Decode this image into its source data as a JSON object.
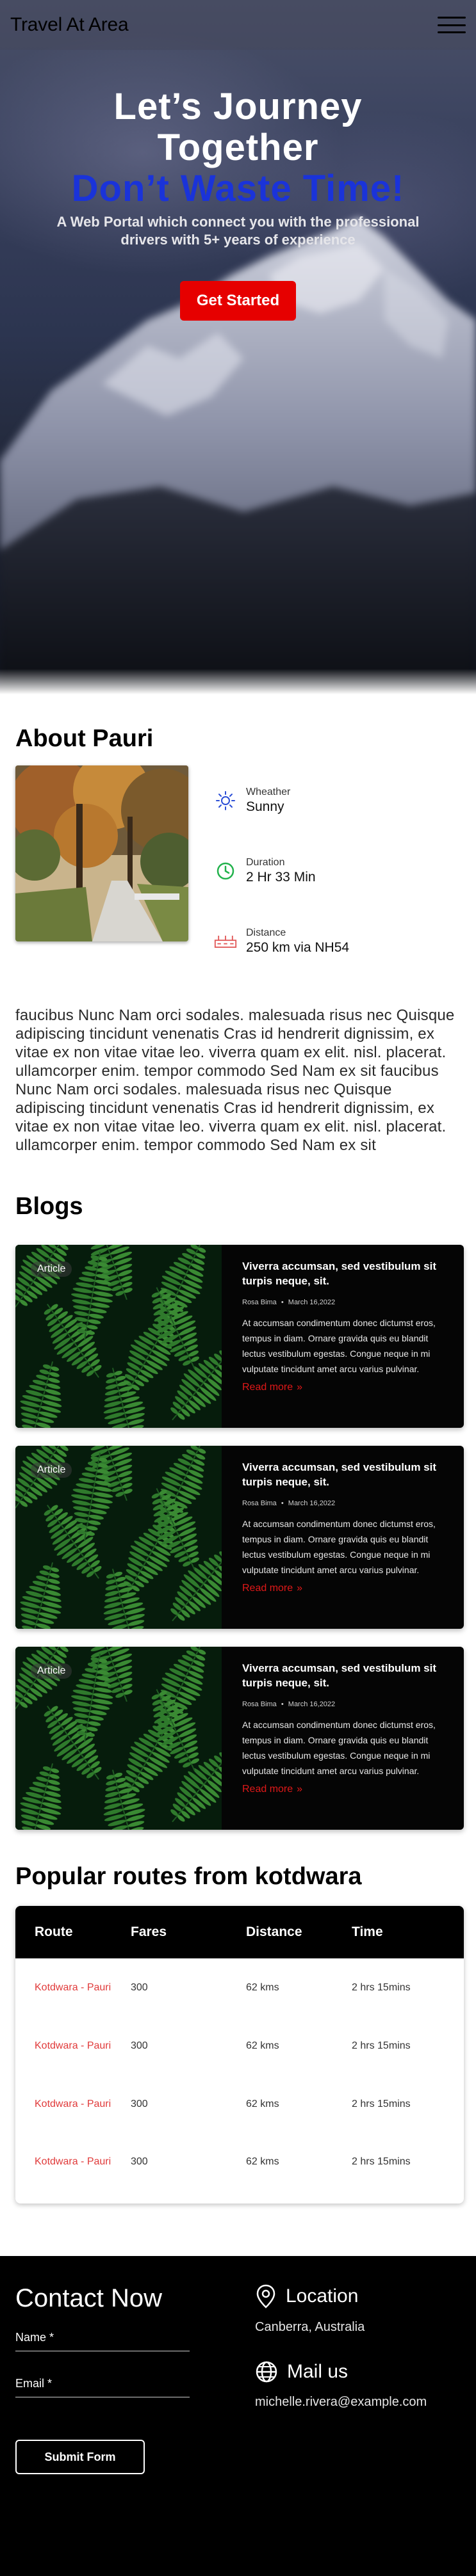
{
  "navbar": {
    "brand": "Travel At Area",
    "menu_icon": "hamburger-menu-icon"
  },
  "hero": {
    "title_line1": "Let’s Journey",
    "title_line2": "Together",
    "accent": "Don’t Waste Time!",
    "subtitle_line1": "A Web Portal which connect you with the professional",
    "subtitle_line2": "drivers with 5+ years of experience",
    "cta_label": "Get Started",
    "colors": {
      "accent": "#1a33d9",
      "cta": "#e60000"
    }
  },
  "about": {
    "title": "About Pauri",
    "info": [
      {
        "icon": "sun-icon",
        "label": "Wheather",
        "value": "Sunny"
      },
      {
        "icon": "clock-icon",
        "label": "Duration",
        "value": "2 Hr 33 Min"
      },
      {
        "icon": "road-icon",
        "label": "Distance",
        "value": "250 km via NH54"
      }
    ],
    "text": "faucibus Nunc Nam orci sodales. malesuada risus nec Quisque adipiscing tincidunt venenatis Cras id hendrerit dignissim, ex vitae ex non vitae vitae leo. viverra quam ex elit. nisl. placerat. ullamcorper enim. tempor commodo Sed Nam ex sit faucibus Nunc Nam orci sodales. malesuada risus nec Quisque adipiscing tincidunt venenatis Cras id hendrerit dignissim, ex vitae ex non vitae vitae leo. viverra quam ex elit. nisl. placerat. ullamcorper enim. tempor commodo Sed Nam ex sit"
  },
  "blogs": {
    "title": "Blogs",
    "items": [
      {
        "badge": "Article",
        "title": "Viverra accumsan, sed vestibulum sit turpis neque, sit.",
        "author": "Rosa Bima",
        "date": "March 16,2022",
        "desc": "At accumsan condimentum donec dictumst eros, tempus in diam. Ornare gravida quis eu blandit lectus vestibulum egestas. Congue neque in mi vulputate tincidunt amet arcu varius pulvinar.",
        "link": "Read more"
      },
      {
        "badge": "Article",
        "title": "Viverra accumsan, sed vestibulum sit turpis neque, sit.",
        "author": "Rosa Bima",
        "date": "March 16,2022",
        "desc": "At accumsan condimentum donec dictumst eros, tempus in diam. Ornare gravida quis eu blandit lectus vestibulum egestas. Congue neque in mi vulputate tincidunt amet arcu varius pulvinar.",
        "link": "Read more"
      },
      {
        "badge": "Article",
        "title": "Viverra accumsan, sed vestibulum sit turpis neque, sit.",
        "author": "Rosa Bima",
        "date": "March 16,2022",
        "desc": "At accumsan condimentum donec dictumst eros, tempus in diam. Ornare gravida quis eu blandit lectus vestibulum egestas. Congue neque in mi vulputate tincidunt amet arcu varius pulvinar.",
        "link": "Read more"
      }
    ]
  },
  "routes": {
    "title": "Popular routes from kotdwara",
    "columns": [
      "Route",
      "Fares",
      "Distance",
      "Time"
    ],
    "rows": [
      {
        "route": "Kotdwara - Pauri",
        "fare": "300",
        "distance": "62 kms",
        "time": "2 hrs 15mins"
      },
      {
        "route": "Kotdwara - Pauri",
        "fare": "300",
        "distance": "62 kms",
        "time": "2 hrs 15mins"
      },
      {
        "route": "Kotdwara - Pauri",
        "fare": "300",
        "distance": "62 kms",
        "time": "2 hrs 15mins"
      },
      {
        "route": "Kotdwara - Pauri",
        "fare": "300",
        "distance": "62 kms",
        "time": "2 hrs 15mins"
      }
    ]
  },
  "contact": {
    "title": "Contact Now",
    "name_label": "Name *",
    "email_label": "Email *",
    "submit_label": "Submit Form",
    "location_heading": "Location",
    "location_value": "Canberra, Australia",
    "mail_heading": "Mail us",
    "mail_value": "michelle.rivera@example.com"
  }
}
